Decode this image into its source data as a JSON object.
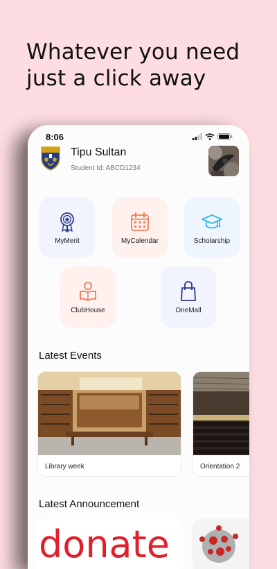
{
  "headline": {
    "line1": "Whatever you need",
    "line2": "just a click away"
  },
  "status_bar": {
    "time": "8:06"
  },
  "profile": {
    "name": "Tipu Sultan",
    "student_id": "Student Id: ABCD1234"
  },
  "menu": [
    {
      "label": "MyMerit",
      "icon": "medal-icon"
    },
    {
      "label": "MyCalendar",
      "icon": "calendar-icon"
    },
    {
      "label": "Scholarship",
      "icon": "graduation-cap-icon"
    },
    {
      "label": "ClubHouse",
      "icon": "reading-person-icon"
    },
    {
      "label": "OneMall",
      "icon": "shopping-bag-icon"
    }
  ],
  "events": {
    "title": "Latest Events",
    "items": [
      {
        "label": "Library week"
      },
      {
        "label": "Orientation 2"
      }
    ]
  },
  "announcements": {
    "title": "Latest Announcement",
    "items": [
      {
        "text": "donate"
      }
    ]
  },
  "colors": {
    "background": "#fddde2",
    "accent_blue": "#2a3a8c",
    "accent_orange": "#f07b52",
    "accent_cyan": "#35b6e6",
    "announce_red": "#e0202a"
  }
}
